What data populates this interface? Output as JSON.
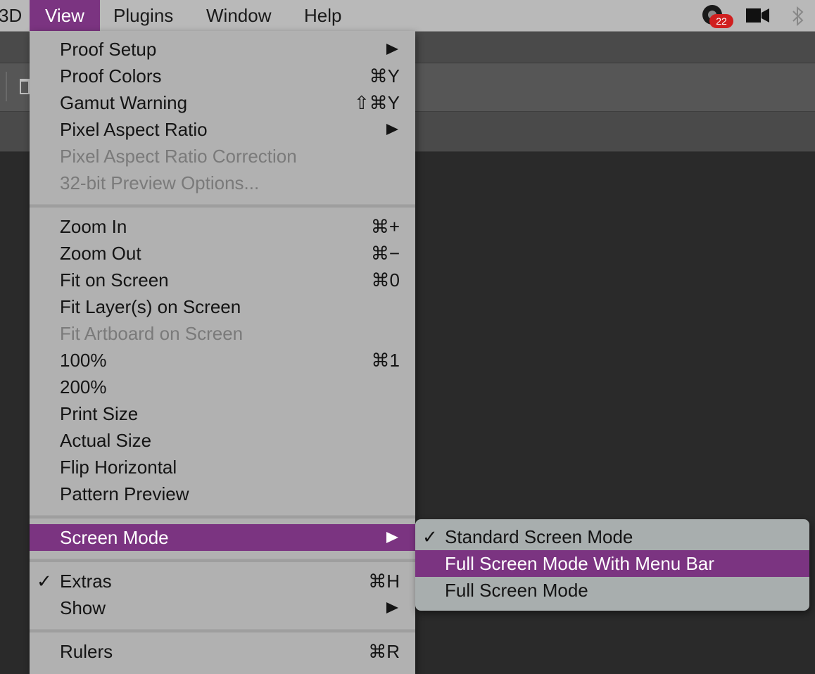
{
  "menubar": {
    "items": [
      {
        "label": "3D",
        "active": false
      },
      {
        "label": "View",
        "active": true
      },
      {
        "label": "Plugins",
        "active": false
      },
      {
        "label": "Window",
        "active": false
      },
      {
        "label": "Help",
        "active": false
      }
    ],
    "status": {
      "notification_count": "22",
      "icons": [
        "notification-app-icon",
        "video-camera-icon",
        "bluetooth-icon"
      ]
    }
  },
  "toolbar": {
    "icons": [
      "move-3d-icon",
      "video-3d-icon"
    ]
  },
  "view_menu": {
    "items": [
      {
        "label": "Proof Setup",
        "shortcut": "",
        "submenu": true,
        "disabled": false,
        "checked": false
      },
      {
        "label": "Proof Colors",
        "shortcut": "⌘Y",
        "submenu": false,
        "disabled": false,
        "checked": false
      },
      {
        "label": "Gamut Warning",
        "shortcut": "⇧⌘Y",
        "submenu": false,
        "disabled": false,
        "checked": false
      },
      {
        "label": "Pixel Aspect Ratio",
        "shortcut": "",
        "submenu": true,
        "disabled": false,
        "checked": false
      },
      {
        "label": "Pixel Aspect Ratio Correction",
        "shortcut": "",
        "submenu": false,
        "disabled": true,
        "checked": false
      },
      {
        "label": "32-bit Preview Options...",
        "shortcut": "",
        "submenu": false,
        "disabled": true,
        "checked": false
      },
      {
        "label": "Zoom In",
        "shortcut": "⌘+",
        "submenu": false,
        "disabled": false,
        "checked": false
      },
      {
        "label": "Zoom Out",
        "shortcut": "⌘−",
        "submenu": false,
        "disabled": false,
        "checked": false
      },
      {
        "label": "Fit on Screen",
        "shortcut": "⌘0",
        "submenu": false,
        "disabled": false,
        "checked": false
      },
      {
        "label": "Fit Layer(s) on Screen",
        "shortcut": "",
        "submenu": false,
        "disabled": false,
        "checked": false
      },
      {
        "label": "Fit Artboard on Screen",
        "shortcut": "",
        "submenu": false,
        "disabled": true,
        "checked": false
      },
      {
        "label": "100%",
        "shortcut": "⌘1",
        "submenu": false,
        "disabled": false,
        "checked": false
      },
      {
        "label": "200%",
        "shortcut": "",
        "submenu": false,
        "disabled": false,
        "checked": false
      },
      {
        "label": "Print Size",
        "shortcut": "",
        "submenu": false,
        "disabled": false,
        "checked": false
      },
      {
        "label": "Actual Size",
        "shortcut": "",
        "submenu": false,
        "disabled": false,
        "checked": false
      },
      {
        "label": "Flip Horizontal",
        "shortcut": "",
        "submenu": false,
        "disabled": false,
        "checked": false
      },
      {
        "label": "Pattern Preview",
        "shortcut": "",
        "submenu": false,
        "disabled": false,
        "checked": false
      },
      {
        "label": "Screen Mode",
        "shortcut": "",
        "submenu": true,
        "disabled": false,
        "checked": false,
        "highlighted": true
      },
      {
        "label": "Extras",
        "shortcut": "⌘H",
        "submenu": false,
        "disabled": false,
        "checked": true
      },
      {
        "label": "Show",
        "shortcut": "",
        "submenu": true,
        "disabled": false,
        "checked": false
      },
      {
        "label": "Rulers",
        "shortcut": "⌘R",
        "submenu": false,
        "disabled": false,
        "checked": false
      }
    ]
  },
  "screen_mode_submenu": {
    "items": [
      {
        "label": "Standard Screen Mode",
        "checked": true,
        "highlighted": false
      },
      {
        "label": "Full Screen Mode With Menu Bar",
        "checked": false,
        "highlighted": true
      },
      {
        "label": "Full Screen Mode",
        "checked": false,
        "highlighted": false
      }
    ]
  },
  "colors": {
    "accent": "#7b3481",
    "menu_bg": "#b1b1b1",
    "disabled_text": "#7a7a7a"
  }
}
